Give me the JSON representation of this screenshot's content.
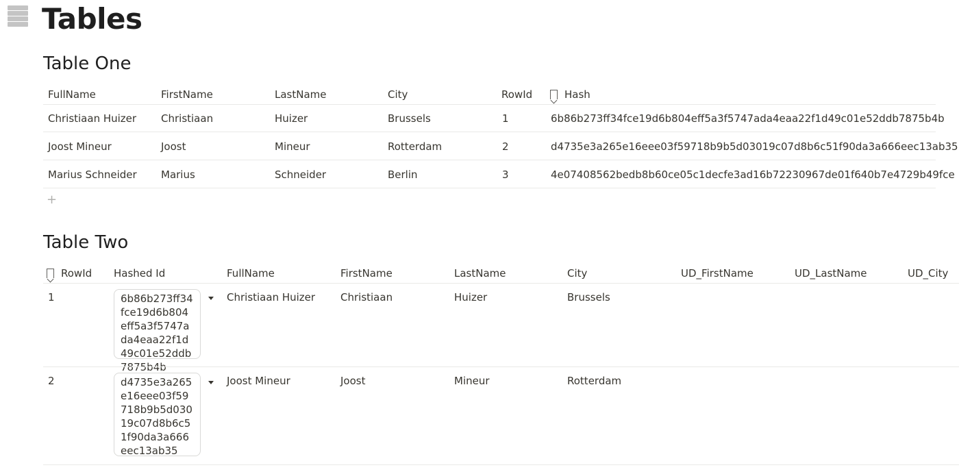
{
  "page": {
    "title": "Tables",
    "icon": "table-icon"
  },
  "table_one": {
    "heading": "Table One",
    "columns": [
      "FullName",
      "FirstName",
      "LastName",
      "City",
      "RowId",
      "Hash"
    ],
    "rows": [
      [
        "Christiaan Huizer",
        "Christiaan",
        "Huizer",
        "Brussels",
        "1",
        "6b86b273ff34fce19d6b804eff5a3f5747ada4eaa22f1d49c01e52ddb7875b4b"
      ],
      [
        "Joost Mineur",
        "Joost",
        "Mineur",
        "Rotterdam",
        "2",
        "d4735e3a265e16eee03f59718b9b5d03019c07d8b6c51f90da3a666eec13ab35"
      ],
      [
        "Marius Schneider",
        "Marius",
        "Schneider",
        "Berlin",
        "3",
        "4e07408562bedb8b60ce05c1decfe3ad16b72230967de01f640b7e4729b49fce"
      ]
    ],
    "add_row": "+"
  },
  "table_two": {
    "heading": "Table Two",
    "columns": [
      "RowId",
      "Hashed Id",
      "FullName",
      "FirstName",
      "LastName",
      "City",
      "UD_FirstName",
      "UD_LastName",
      "UD_City"
    ],
    "rows": [
      [
        "1",
        "6b86b273ff34fce19d6b804eff5a3f5747ada4eaa22f1d49c01e52ddb7875b4b",
        "Christiaan Huizer",
        "Christiaan",
        "Huizer",
        "Brussels",
        "",
        "",
        ""
      ],
      [
        "2",
        "d4735e3a265e16eee03f59718b9b5d03019c07d8b6c51f90da3a666eec13ab35",
        "Joost Mineur",
        "Joost",
        "Mineur",
        "Rotterdam",
        "",
        "",
        ""
      ]
    ]
  }
}
